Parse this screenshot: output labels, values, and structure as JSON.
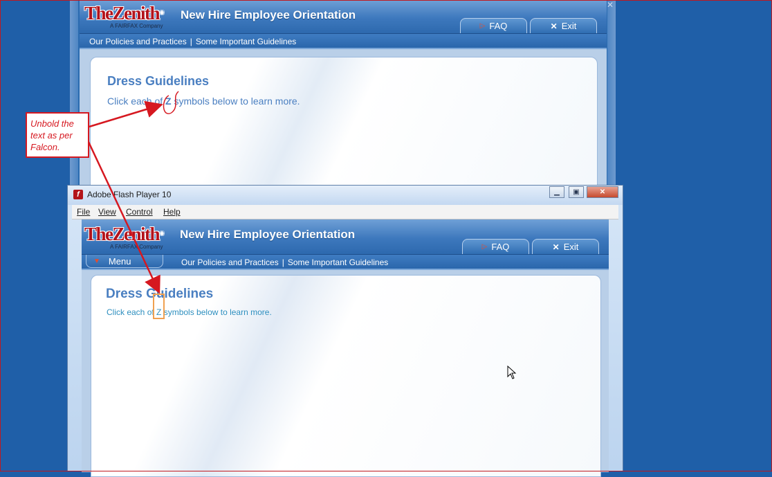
{
  "background_window": {
    "logo": {
      "brand": "TheZenith",
      "tagline": "A FAIRFAX Company"
    },
    "app_title": "New Hire Employee Orientation",
    "faq_label": "FAQ",
    "exit_label": "Exit",
    "breadcrumb": {
      "item1": "Our Policies and Practices",
      "separator": "|",
      "item2": "Some Important Guidelines"
    },
    "page_title": "Dress Guidelines",
    "instruction_prefix": "Click each of ",
    "symbol": "Z",
    "instruction_suffix": " symbols below to learn more."
  },
  "flash_window": {
    "title": "Adobe Flash Player 10",
    "menu": {
      "file": "File",
      "view": "View",
      "control": "Control",
      "help": "Help"
    },
    "logo": {
      "brand": "TheZenith",
      "tagline": "A FAIRFAX Company"
    },
    "app_title": "New Hire Employee Orientation",
    "faq_label": "FAQ",
    "exit_label": "Exit",
    "menu_button_label": "Menu",
    "breadcrumb": {
      "item1": "Our Policies and Practices",
      "separator": "|",
      "item2": "Some Important Guidelines"
    },
    "page_title": "Dress Guidelines",
    "instruction_prefix": "Click each of ",
    "symbol": "Z",
    "instruction_suffix": " symbols below to learn more."
  },
  "annotation": {
    "callout_text": "Unbold the text as per Falcon.",
    "color": "#d61820",
    "highlight_color": "#f0a050"
  },
  "colors": {
    "desktop": "#1f5fa8",
    "brand_red": "#b3131b",
    "heading_blue": "#4a7fc1"
  }
}
